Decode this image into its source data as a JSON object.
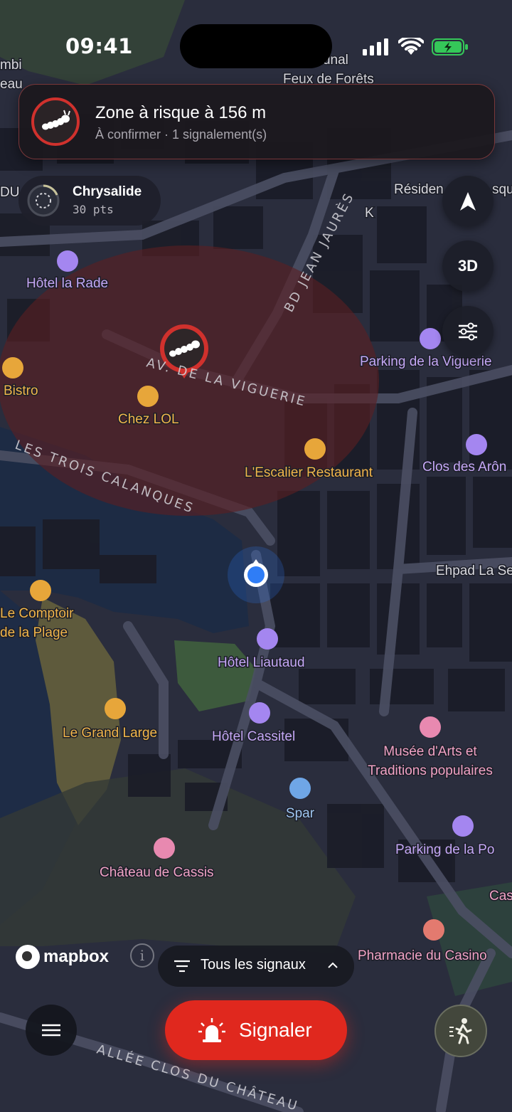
{
  "status_bar": {
    "time": "09:41"
  },
  "alert": {
    "title": "Zone à risque à 156 m",
    "subtitle": "À confirmer · 1 signalement(s)",
    "icon": "caterpillar-icon"
  },
  "level": {
    "name": "Chrysalide",
    "points": "30 pts"
  },
  "controls": {
    "compass_icon": "navigation-arrow-icon",
    "view_3d": "3D",
    "settings_icon": "sliders-icon"
  },
  "map": {
    "attribution": "mapbox",
    "user_location": "blue-dot",
    "risk_zone_color": "#5a1f22",
    "streets": [
      "BD JEAN JAURÈS",
      "AV. DE LA VIGUERIE",
      "LES TROIS CALANQUES",
      "ALLÉE CLOS DU CHÂTEAU"
    ],
    "pois": [
      {
        "name": "Hôtel la Rade",
        "category": "hotel",
        "color": "#c4a7f5"
      },
      {
        "name": "Bistro",
        "category": "restaurant",
        "color": "#f1b54a"
      },
      {
        "name": "Chez LOL",
        "category": "restaurant",
        "color": "#f1b54a"
      },
      {
        "name": "L'Escalier Restaurant",
        "category": "restaurant",
        "color": "#f1b54a"
      },
      {
        "name": "Parking de la Viguerie",
        "category": "parking",
        "color": "#c4a7f5"
      },
      {
        "name": "Clos des Arôn",
        "category": "hotel",
        "color": "#c4a7f5"
      },
      {
        "name": "Ehpad La Se",
        "category": "other",
        "color": "#d8d8de"
      },
      {
        "name": "Le Comptoir de la Plage",
        "category": "cafe",
        "color": "#f1b54a"
      },
      {
        "name": "Hôtel Liautaud",
        "category": "hotel",
        "color": "#c4a7f5"
      },
      {
        "name": "Le Grand Large",
        "category": "restaurant",
        "color": "#f1b54a"
      },
      {
        "name": "Hôtel Cassitel",
        "category": "hotel",
        "color": "#c4a7f5"
      },
      {
        "name": "Musée d'Arts et Traditions populaires",
        "category": "museum",
        "color": "#f0a2c4"
      },
      {
        "name": "Spar",
        "category": "grocery",
        "color": "#9ec5f0"
      },
      {
        "name": "Parking de la Po",
        "category": "parking",
        "color": "#c4a7f5"
      },
      {
        "name": "Château de Cassis",
        "category": "landmark",
        "color": "#f0a2c4"
      },
      {
        "name": "Cas",
        "category": "other",
        "color": "#f0a2c4"
      },
      {
        "name": "Pharmacie du Casino",
        "category": "pharmacy",
        "color": "#f0a2c4"
      },
      {
        "name": "Résiden",
        "category": "other",
        "color": "#d8d8de"
      },
      {
        "name": "squ",
        "category": "other",
        "color": "#d8d8de"
      },
      {
        "name": "Communal Feux de Forêts",
        "category": "other",
        "color": "#d8d8de"
      },
      {
        "name": "mbi eau",
        "category": "other",
        "color": "#d8d8de"
      },
      {
        "name": "DU",
        "category": "other",
        "color": "#d8d8de"
      },
      {
        "name": "K",
        "category": "other",
        "color": "#d8d8de"
      }
    ]
  },
  "bottom": {
    "filter_label": "Tous les signaux",
    "report_label": "Signaler",
    "menu_icon": "hamburger-icon",
    "walk_icon": "walking-person-icon",
    "report_icon": "siren-icon"
  },
  "colors": {
    "accent_red": "#e0281e",
    "alert_border": "#d0312d",
    "user_blue": "#2f7df6"
  }
}
